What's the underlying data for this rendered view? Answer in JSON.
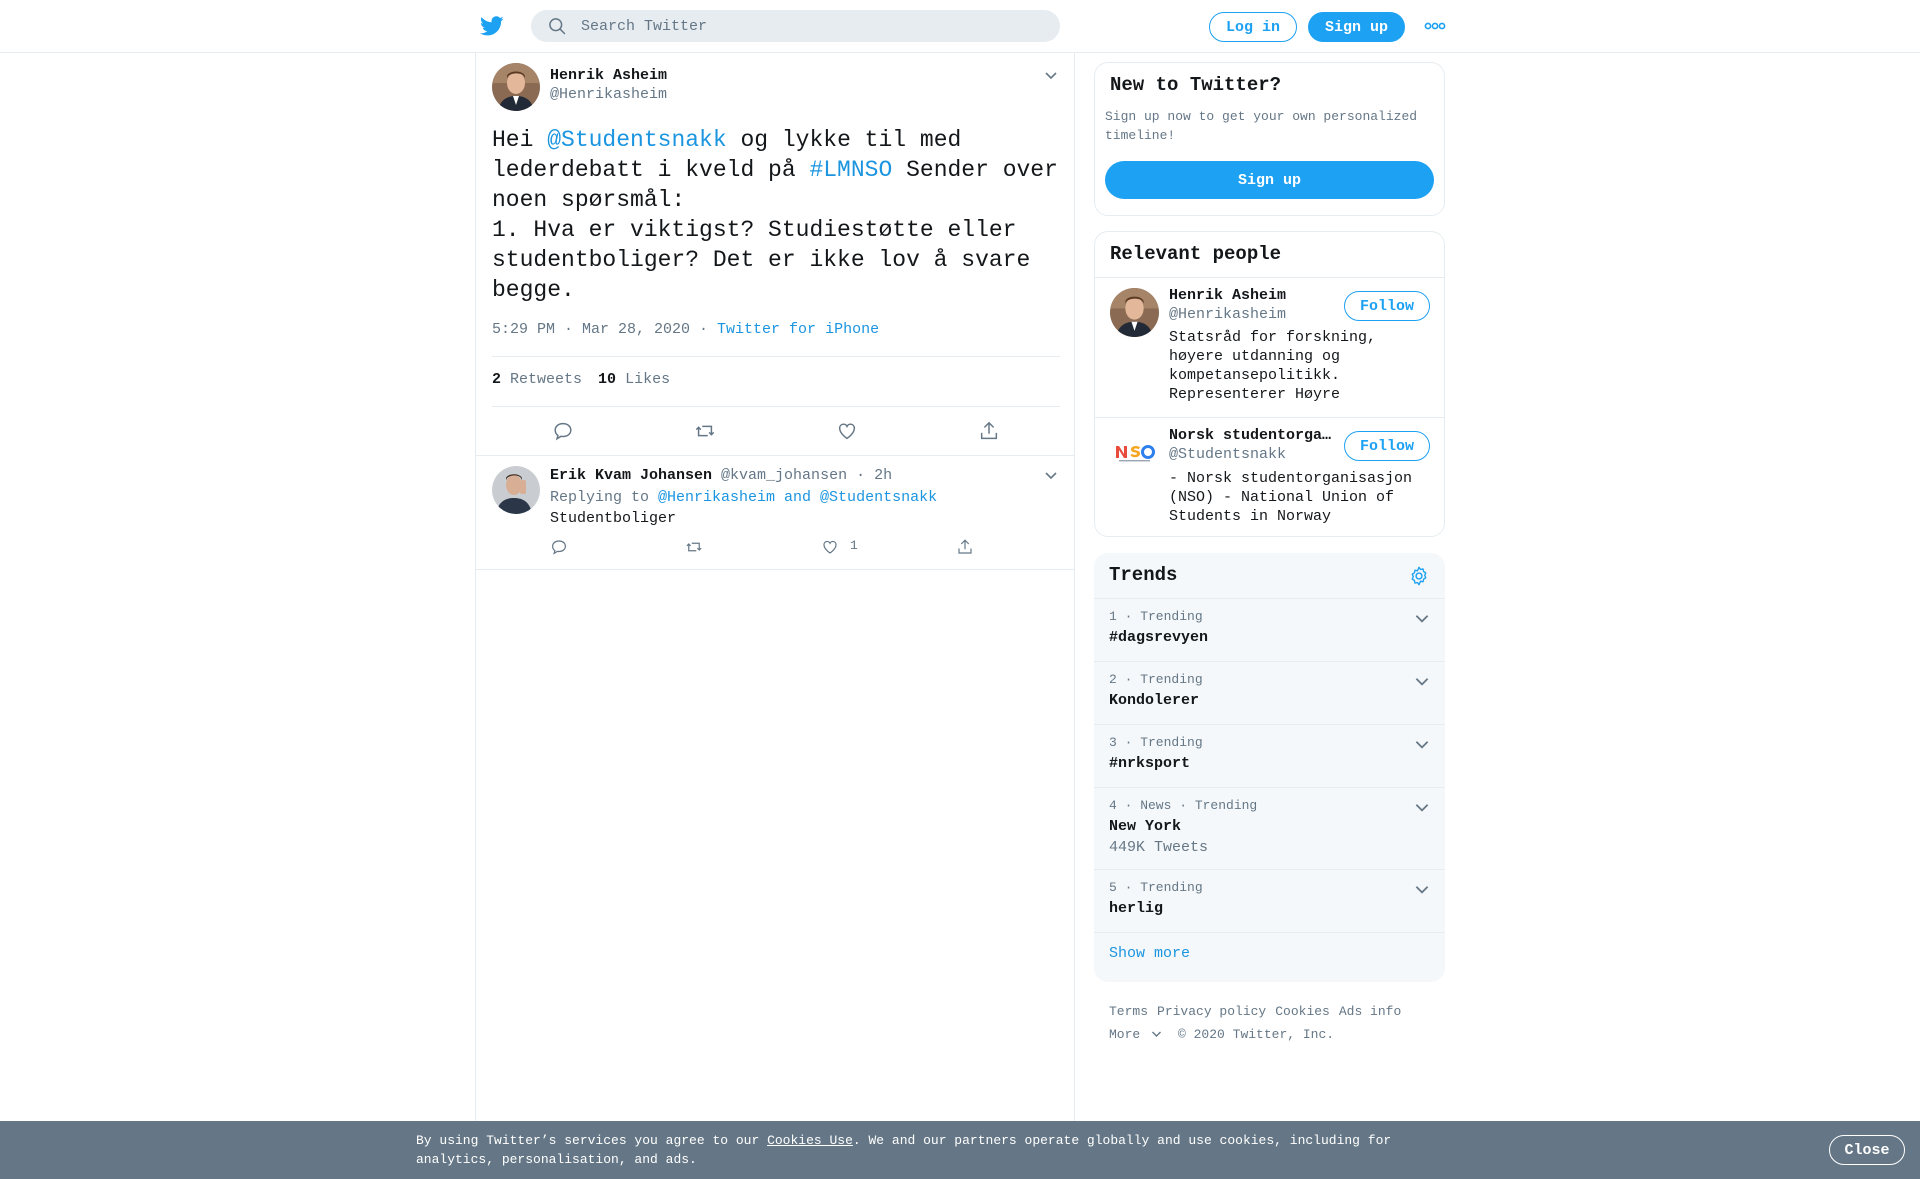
{
  "header": {
    "search_placeholder": "Search Twitter",
    "login_label": "Log in",
    "signup_label": "Sign up"
  },
  "tweet": {
    "author_name": "Henrik Asheim",
    "author_handle": "@Henrikasheim",
    "text_part1": "Hei ",
    "mention": "@Studentsnakk",
    "text_part2": " og lykke til med lederdebatt i kveld på ",
    "hashtag": "#LMNSO",
    "text_part3": " Sender over noen spørsmål:",
    "text_line2": "1. Hva er viktigst? Studiestøtte eller studentboliger? Det er ikke lov å svare begge.",
    "timestamp": "5:29 PM · Mar 28, 2020 · ",
    "source": "Twitter for iPhone",
    "retweets_count": "2",
    "retweets_label": "Retweets",
    "likes_count": "10",
    "likes_label": "Likes"
  },
  "reply": {
    "author_name": "Erik Kvam Johansen",
    "author_handle": "@kvam_johansen",
    "time": " · 2h",
    "replying_prefix": "Replying to ",
    "replying_to": "@Henrikasheim and @Studentsnakk",
    "text": "Studentboliger",
    "like_count": "1"
  },
  "new_to_twitter": {
    "title": "New to Twitter?",
    "description": "Sign up now to get your own personalized timeline!",
    "button_label": "Sign up"
  },
  "relevant_people": {
    "title": "Relevant people",
    "people": [
      {
        "name": "Henrik Asheim",
        "handle": "@Henrikasheim",
        "bio": "Statsråd for forskning, høyere utdanning og kompetansepolitikk. Representerer Høyre",
        "follow_label": "Follow"
      },
      {
        "name": "Norsk studentorganisasjon",
        "handle": "@Studentsnakk",
        "bio": "- Norsk studentorganisasjon (NSO) - National Union of Students in Norway",
        "follow_label": "Follow"
      }
    ]
  },
  "trends": {
    "title": "Trends",
    "items": [
      {
        "meta": "1 · Trending",
        "name": "#dagsrevyen",
        "count": ""
      },
      {
        "meta": "2 · Trending",
        "name": "Kondolerer",
        "count": ""
      },
      {
        "meta": "3 · Trending",
        "name": "#nrksport",
        "count": ""
      },
      {
        "meta": "4 · News · Trending",
        "name": "New York",
        "count": "449K Tweets"
      },
      {
        "meta": "5 · Trending",
        "name": "herlig",
        "count": ""
      }
    ],
    "show_more": "Show more"
  },
  "footer": {
    "links": [
      "Terms",
      "Privacy policy",
      "Cookies",
      "Ads info"
    ],
    "more": "More",
    "copyright": "© 2020 Twitter, Inc."
  },
  "cookie_bar": {
    "text_before": "By using Twitter’s services you agree to our ",
    "link": "Cookies Use",
    "text_after": ". We and our partners operate globally and use cookies, including for analytics, personalisation, and ads.",
    "close_label": "Close"
  },
  "colors": {
    "brand": "#1da1f2",
    "link": "#1b95e0",
    "secondary_text": "#657786",
    "cookie_bar": "#657786"
  }
}
